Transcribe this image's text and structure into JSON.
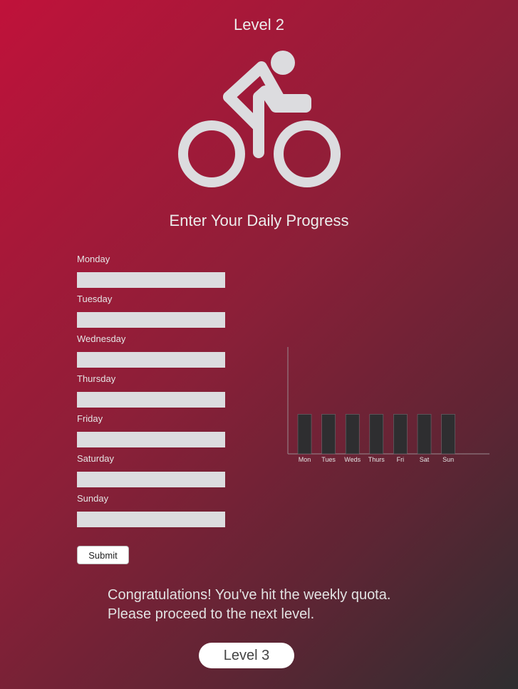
{
  "header": {
    "level_title": "Level 2",
    "icon": "bicycle-rider-icon"
  },
  "form": {
    "heading": "Enter Your Daily Progress",
    "days": [
      {
        "label": "Monday",
        "value": ""
      },
      {
        "label": "Tuesday",
        "value": ""
      },
      {
        "label": "Wednesday",
        "value": ""
      },
      {
        "label": "Thursday",
        "value": ""
      },
      {
        "label": "Friday",
        "value": ""
      },
      {
        "label": "Saturday",
        "value": ""
      },
      {
        "label": "Sunday",
        "value": ""
      }
    ],
    "submit_label": "Submit"
  },
  "chart_data": {
    "type": "bar",
    "categories": [
      "Mon",
      "Tues",
      "Weds",
      "Thurs",
      "Fri",
      "Sat",
      "Sun"
    ],
    "values": [
      1,
      1,
      1,
      1,
      1,
      1,
      1
    ],
    "ylim": [
      0,
      2.7
    ],
    "bar_color": "#2e2e30",
    "grid": false
  },
  "message": {
    "line1": "Congratulations! You've hit the weekly quota.",
    "line2": "Please proceed to the next level."
  },
  "next": {
    "label": "Level 3"
  },
  "colors": {
    "background_start": "#c0123a",
    "background_end": "#2e2e30",
    "icon": "#dcdcdf"
  }
}
